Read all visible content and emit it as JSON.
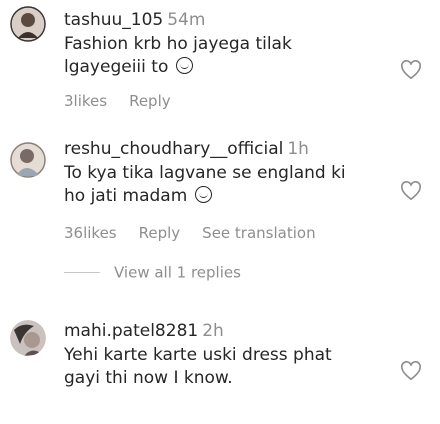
{
  "comments": [
    {
      "username": "tashuu_105",
      "time": "54m",
      "text_line1": "Fashion krb ho jayega tilak",
      "text_line2": "lgayegeiii to",
      "likes": "3likes",
      "reply": "Reply",
      "avatar_color": "#5b4a3f"
    },
    {
      "username": "reshu_choudhary__official",
      "time": "1h",
      "text_line1": "To kya tika lagvane se england ki",
      "text_line2": "ho jati madam",
      "likes": "36likes",
      "reply": "Reply",
      "see_translation": "See translation",
      "avatar_color": "#7a6a66"
    },
    {
      "username": "mahi.patel8281",
      "time": "2h",
      "text_line1": "Yehi karte karte uski dress phat",
      "text_line2": "gayi thi now I know.",
      "avatar_color": "#3a3432"
    }
  ],
  "view_replies": "View all 1 replies",
  "colors": {
    "text": "#262626",
    "muted": "#8e8e8e",
    "divider": "#c7c7c7"
  },
  "icons": [
    "heart-outline-icon",
    "smiling-emoji-icon"
  ]
}
